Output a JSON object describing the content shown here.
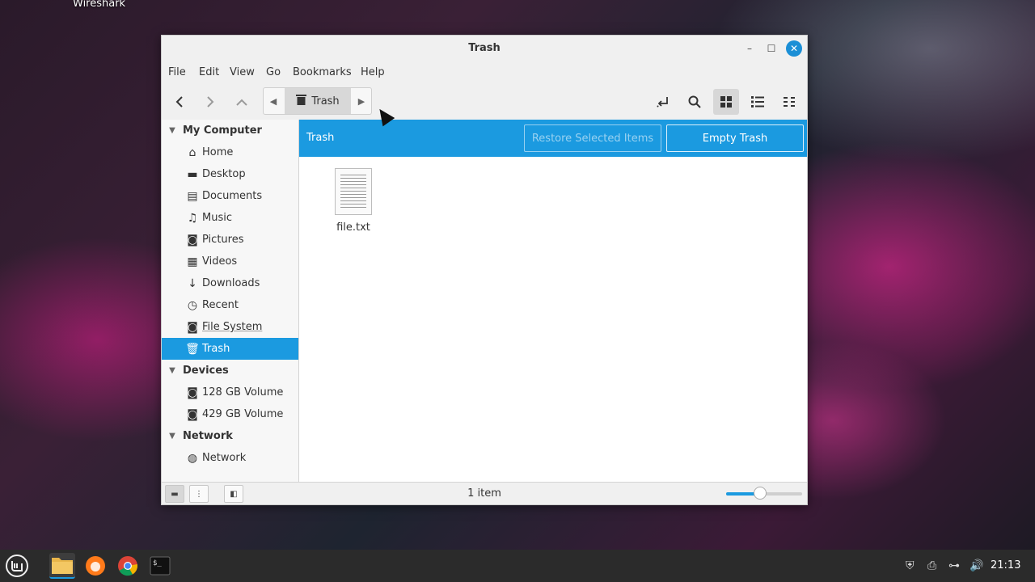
{
  "desktop": {
    "label": "Wireshark"
  },
  "window": {
    "title": "Trash",
    "controls": {
      "minimize": "–",
      "maximize": "☐",
      "close": "✕"
    }
  },
  "menubar": {
    "items": [
      "File",
      "Edit",
      "View",
      "Go",
      "Bookmarks",
      "Help"
    ]
  },
  "toolbar": {
    "breadcrumb": "Trash",
    "icons": [
      "back-icon",
      "forward-icon",
      "up-icon",
      "toggle-location-icon",
      "search-icon",
      "icon-view-icon",
      "list-view-icon",
      "compact-view-icon"
    ]
  },
  "sidebar": {
    "sections": [
      {
        "title": "My Computer",
        "items": [
          "Home",
          "Desktop",
          "Documents",
          "Music",
          "Pictures",
          "Videos",
          "Downloads",
          "Recent",
          "File System",
          "Trash"
        ]
      },
      {
        "title": "Devices",
        "items": [
          "128 GB Volume",
          "429 GB Volume"
        ]
      },
      {
        "title": "Network",
        "items": [
          "Network"
        ]
      }
    ],
    "selected": "Trash"
  },
  "infobar": {
    "title": "Trash",
    "restore_label": "Restore Selected Items",
    "empty_label": "Empty Trash"
  },
  "files": [
    {
      "name": "file.txt"
    }
  ],
  "statusbar": {
    "text": "1 item",
    "zoom": 0.45
  },
  "taskbar": {
    "apps": [
      "menu-icon",
      "files-icon",
      "firefox-icon",
      "chrome-icon",
      "terminal-icon"
    ],
    "clock": "21:13"
  },
  "colors": {
    "accent": "#1b9ae0",
    "close_button": "#1b8fd6"
  }
}
